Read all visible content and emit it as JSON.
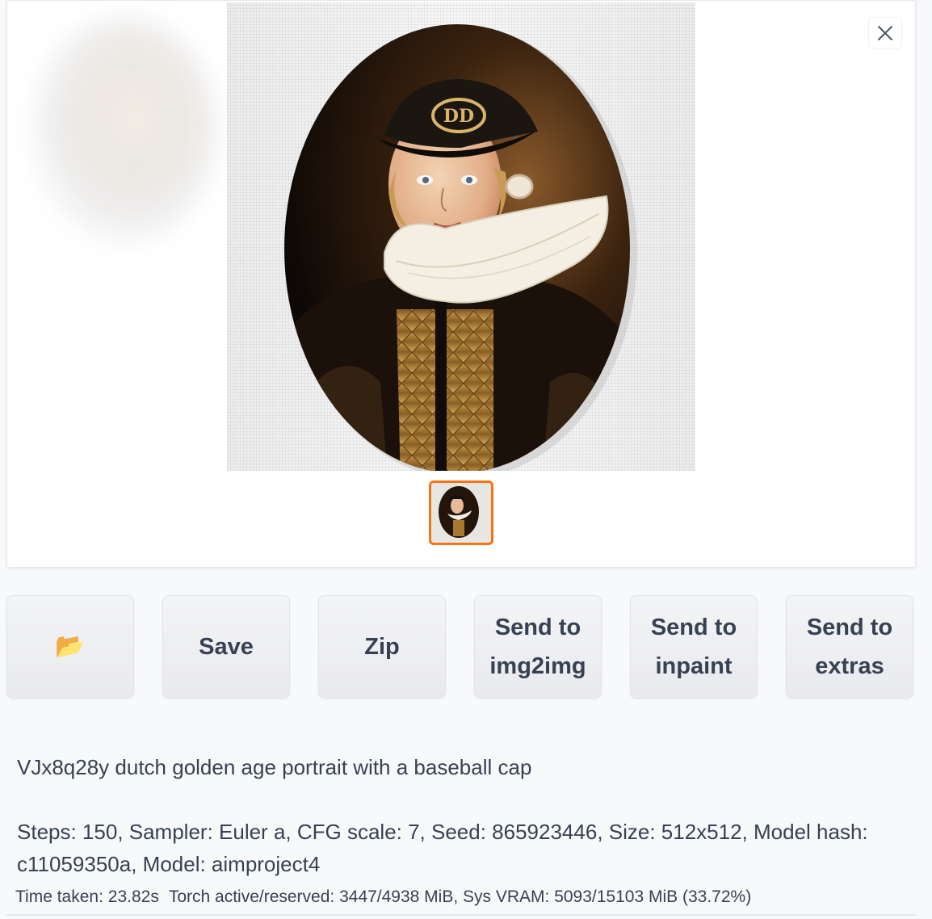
{
  "gallery": {
    "close_icon": "close-icon",
    "main_image_description_icon": "portrait-image",
    "thumbnail_selected": true,
    "accent_color": "#f97316"
  },
  "buttons": {
    "open_folder": {
      "icon": "folder-icon",
      "glyph": "📂"
    },
    "save": "Save",
    "zip": "Zip",
    "send_img2img": "Send to\nimg2img",
    "send_inpaint": "Send to\ninpaint",
    "send_extras": "Send to\nextras"
  },
  "generation_info": {
    "prompt": "VJx8q28y dutch golden age portrait with a baseball cap",
    "params": "Steps: 150, Sampler: Euler a, CFG scale: 7, Seed: 865923446, Size: 512x512, Model hash: c11059350a, Model: aimproject4"
  },
  "performance": {
    "time_taken": "Time taken: 23.82s",
    "memory": "Torch active/reserved: 3447/4938 MiB, Sys VRAM: 5093/15103 MiB (33.72%)"
  }
}
